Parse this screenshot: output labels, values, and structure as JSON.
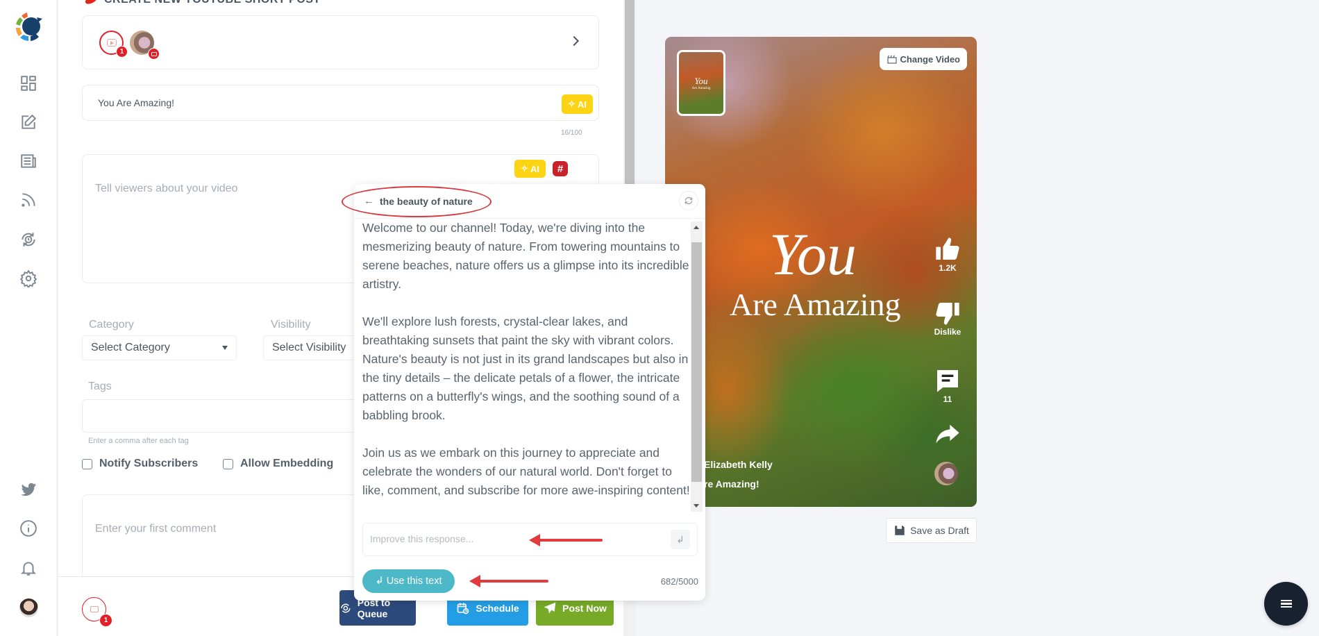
{
  "page": {
    "title": "CREATE NEW YOUTUBE SHORT POST"
  },
  "sidebar": {
    "items": [
      {
        "name": "dashboard",
        "icon": "dashboard-icon"
      },
      {
        "name": "compose",
        "icon": "edit-icon"
      },
      {
        "name": "posts",
        "icon": "newspaper-icon"
      },
      {
        "name": "feeds",
        "icon": "rss-icon"
      },
      {
        "name": "schedule",
        "icon": "clock-sync-icon"
      },
      {
        "name": "settings",
        "icon": "gear-icon"
      }
    ],
    "bottom_items": [
      {
        "name": "twitter",
        "icon": "twitter-icon"
      },
      {
        "name": "info",
        "icon": "info-icon"
      },
      {
        "name": "notifications",
        "icon": "bell-icon"
      },
      {
        "name": "profile",
        "icon": "avatar"
      }
    ]
  },
  "accounts": {
    "selected_count": "1",
    "platform": "YouTube"
  },
  "form": {
    "title_value": "You Are Amazing!",
    "ai_label": "AI",
    "title_counter": "16/100",
    "description_placeholder": "Tell viewers about your video",
    "hashtag_label": "#",
    "category_label": "Category",
    "category_value": "Select Category",
    "visibility_label": "Visibility",
    "visibility_value": "Select Visibility",
    "tags_label": "Tags",
    "tags_hint": "Enter a comma after each tag",
    "notify_label": "Notify Subscribers",
    "notify_checked": false,
    "embed_label": "Allow Embedding",
    "embed_checked": false,
    "comment_placeholder": "Enter your first comment"
  },
  "bottom_bar": {
    "queue_count": "1",
    "post_to_queue": "Post to Queue",
    "schedule": "Schedule",
    "post_now": "Post Now"
  },
  "ai_popup": {
    "topic": "the beauty of nature",
    "back_arrow": "←",
    "paragraphs": [
      "Welcome to our channel! Today, we're diving into the mesmerizing beauty of nature. From towering mountains to serene beaches, nature offers us a glimpse into its incredible artistry.",
      "We'll explore lush forests, crystal-clear lakes, and breathtaking sunsets that paint the sky with vibrant colors. Nature's beauty is not just in its grand landscapes but also in the tiny details – the delicate petals of a flower, the intricate patterns on a butterfly's wings, and the soothing sound of a babbling brook.",
      "Join us as we embark on this journey to appreciate and celebrate the wonders of our natural world. Don't forget to like, comment, and subscribe for more awe-inspiring content!"
    ],
    "improve_placeholder": "Improve this response...",
    "enter_symbol": "↲",
    "use_text_label": "↲ Use this text",
    "char_count": "682/5000"
  },
  "preview": {
    "change_video": "Change Video",
    "overlay_line1": "You",
    "overlay_line2": "Are Amazing",
    "thumb_line1": "You",
    "thumb_line2": "Are Amazing",
    "likes": "1.2K",
    "dislike_label": "Dislike",
    "comments": "11",
    "channel_name": "Elizabeth Kelly",
    "video_title": "re Amazing!",
    "save_draft": "Save as Draft"
  },
  "colors": {
    "youtube_red": "#e41e25",
    "ai_yellow": "#fcd413",
    "queue_blue": "#2d4a7c",
    "schedule_blue": "#239ee6",
    "post_now_green": "#77aa27",
    "use_text_teal": "#4cb8c8",
    "annotation_red": "#e23a3f"
  }
}
